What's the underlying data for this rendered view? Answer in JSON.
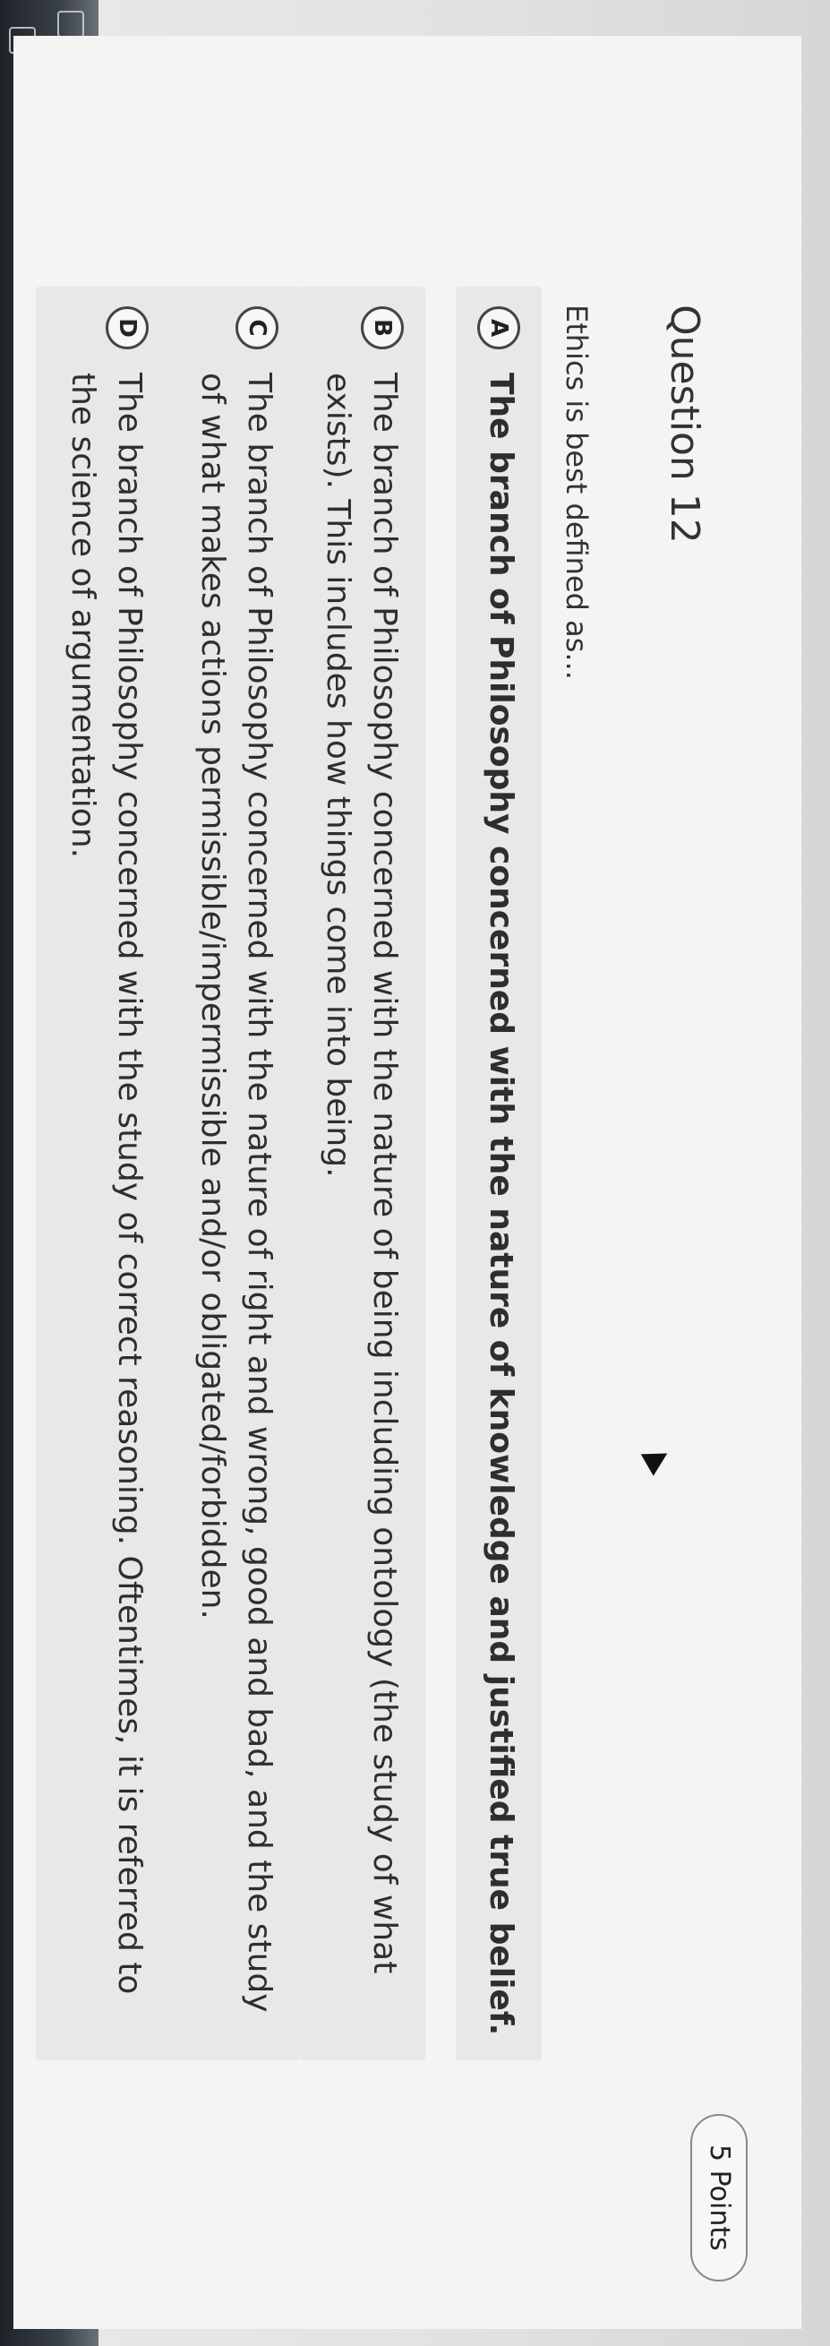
{
  "question": {
    "title": "Question 12",
    "points": "5 Points",
    "prompt": "Ethics is best defined as..."
  },
  "options": [
    {
      "letter": "A",
      "text": "The branch of Philosophy concerned with the nature of knowledge and justified true belief."
    },
    {
      "letter": "B",
      "text": "The branch of Philosophy concerned with the nature of being including ontology (the study of what exists). This includes how things come into being."
    },
    {
      "letter": "C",
      "text": "The branch of Philosophy concerned with the nature of right and wrong, good and bad, and the study of what makes actions permissible/impermissible and/or obligated/forbidden."
    },
    {
      "letter": "D",
      "text": "The branch of Philosophy concerned with the study of correct reasoning. Oftentimes, it is referred to the science of argumentation."
    }
  ],
  "selected_option": "A",
  "icons": [
    "mail-icon",
    "calendar-icon",
    "folder-icon",
    "globe-icon",
    "person-icon",
    "pointer-cursor-icon"
  ]
}
